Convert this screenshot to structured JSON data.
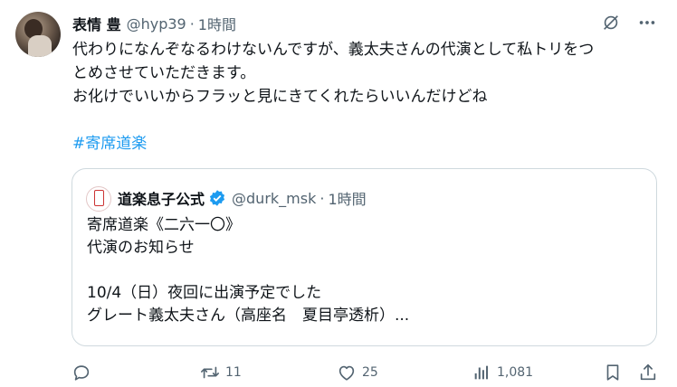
{
  "tweet": {
    "author_name": "表情 豊",
    "author_handle": "@hyp39",
    "separator": "·",
    "time": "1時間",
    "text_lines": [
      "代わりになんぞなるわけないんですが、義太夫さんの代演として私トリをつ",
      "とめさせていただきます。",
      "お化けでいいからフラッと見にきてくれたらいいんだけどね"
    ],
    "hashtag": "#寄席道楽"
  },
  "quote": {
    "author_name": "道楽息子公式",
    "author_handle": "@durk_msk",
    "separator": "·",
    "time": "1時間",
    "text_lines": [
      "寄席道楽《二六一〇》",
      "代演のお知らせ",
      "",
      "10/4（日）夜回に出演予定でした",
      "グレート義太夫さん（高座名　夏目亭透析）..."
    ]
  },
  "actions": {
    "retweets": "11",
    "likes": "25",
    "views": "1,081"
  },
  "icons": {
    "top": [
      "grok-icon",
      "more-icon"
    ],
    "actions": [
      "reply-icon",
      "retweet-icon",
      "like-icon",
      "views-icon",
      "bookmark-icon",
      "share-icon"
    ],
    "verified": "verified-badge-icon"
  },
  "colors": {
    "text": "#0f1419",
    "secondary": "#536471",
    "link": "#1d9bf0",
    "border": "#cfd9de",
    "verified": "#1d9bf0"
  }
}
